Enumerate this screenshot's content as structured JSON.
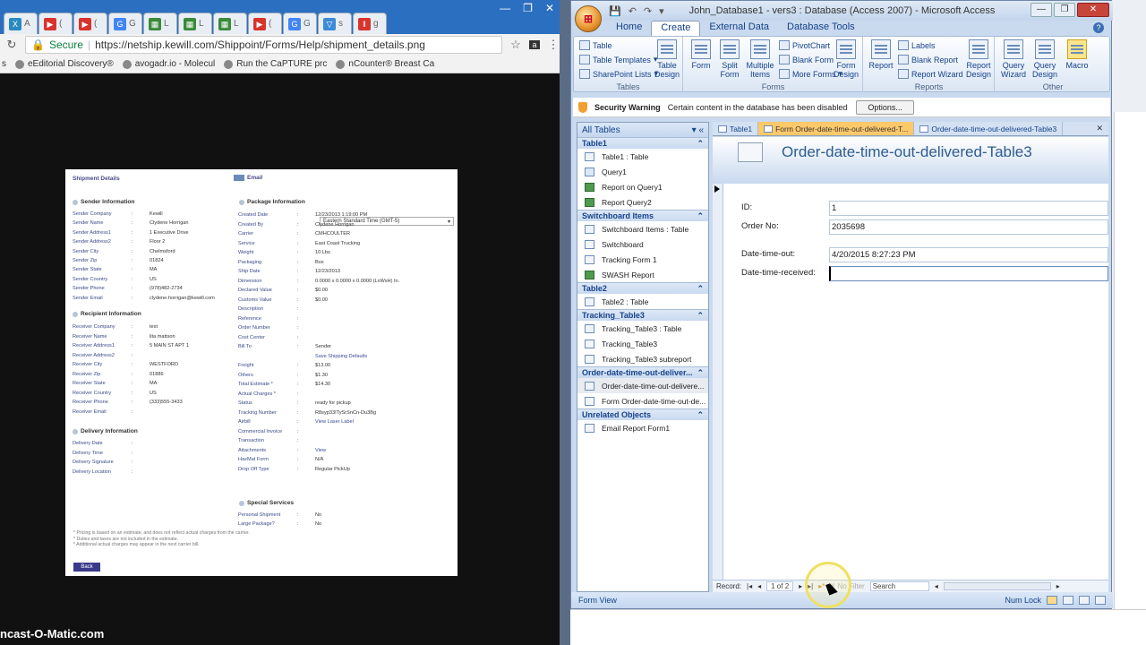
{
  "chrome": {
    "tabs": [
      {
        "fav": "X",
        "fav_color": "#2a8ac0",
        "text": "A"
      },
      {
        "fav": "▶",
        "fav_color": "#d8342c",
        "text": "("
      },
      {
        "fav": "▶",
        "fav_color": "#d8342c",
        "text": "("
      },
      {
        "fav": "G",
        "fav_color": "#4285f4",
        "text": "G"
      },
      {
        "fav": "▦",
        "fav_color": "#3a8a3a",
        "text": "L"
      },
      {
        "fav": "▦",
        "fav_color": "#3a8a3a",
        "text": "L"
      },
      {
        "fav": "▦",
        "fav_color": "#3a8a3a",
        "text": "L"
      },
      {
        "fav": "▶",
        "fav_color": "#d8342c",
        "text": "("
      },
      {
        "fav": "G",
        "fav_color": "#4285f4",
        "text": "G"
      },
      {
        "fav": "▽",
        "fav_color": "#3b8ad8",
        "text": "s"
      },
      {
        "fav": "‖",
        "fav_color": "#d8342c",
        "text": "g"
      }
    ],
    "secure_label": "Secure",
    "url": "https://netship.kewill.com/Shippoint/Forms/Help/shipment_details.png",
    "bookmarks": [
      "eEditorial Discovery®",
      "avogadr.io - Molecul",
      "Run the CaPTURE prc",
      "nCounter® Breast Ca"
    ]
  },
  "shipment": {
    "title": "Shipment Details",
    "email_link": "Email",
    "sender_header": "Sender Information",
    "sender_rows": [
      {
        "l": "Sender Company",
        "v": "Kewill"
      },
      {
        "l": "Sender Name",
        "v": "Clydene Horrigan"
      },
      {
        "l": "Sender Address1",
        "v": "1 Executive Drive"
      },
      {
        "l": "Sender Address2",
        "v": "Floor 2"
      },
      {
        "l": "Sender City",
        "v": "Chelmsford"
      },
      {
        "l": "Sender Zip",
        "v": "01824"
      },
      {
        "l": "Sender State",
        "v": "MA"
      },
      {
        "l": "Sender Country",
        "v": "US"
      },
      {
        "l": "Sender Phone",
        "v": "(978)482-2734"
      },
      {
        "l": "Sender Email",
        "v": "clydene.horrigan@kewill.com"
      }
    ],
    "recipient_header": "Recipient Information",
    "recipient_rows": [
      {
        "l": "Receiver Company",
        "v": "test"
      },
      {
        "l": "Receiver Name",
        "v": "lita mattson"
      },
      {
        "l": "Receiver Address1",
        "v": "5 MAIN ST APT 1"
      },
      {
        "l": "Receiver Address2",
        "v": ""
      },
      {
        "l": "Receiver City",
        "v": "WESTFORD"
      },
      {
        "l": "Receiver Zip",
        "v": "01886"
      },
      {
        "l": "Receiver State",
        "v": "MA"
      },
      {
        "l": "Receiver Country",
        "v": "US"
      },
      {
        "l": "Receiver Phone",
        "v": "(333)555-3433"
      },
      {
        "l": "Receiver Email",
        "v": ""
      }
    ],
    "delivery_header": "Delivery Information",
    "delivery_rows": [
      {
        "l": "Delivery Date",
        "v": ""
      },
      {
        "l": "Delivery Time",
        "v": ""
      },
      {
        "l": "Delivery Signature",
        "v": ""
      },
      {
        "l": "Delivery Location",
        "v": ""
      }
    ],
    "package_header": "Package Information",
    "timezone": "Eastern Standard Time (GMT-5)",
    "package_rows": [
      {
        "l": "Created Date",
        "v": "12/23/2013 1:19:00 PM"
      },
      {
        "l": "Created By",
        "v": "Clydene Horrigan"
      },
      {
        "l": "Carrier",
        "v": "CMHCOULTER"
      },
      {
        "l": "Service",
        "v": "East Coast Trucking"
      },
      {
        "l": "Weight",
        "v": "10 Lbs"
      },
      {
        "l": "Packaging",
        "v": "Box"
      },
      {
        "l": "Ship Date",
        "v": "12/23/2013"
      },
      {
        "l": "Dimension",
        "v": "0.0000 x 0.0000 x 0.0000 (LxWxH) In."
      },
      {
        "l": "Declared Value",
        "v": "$0.00"
      },
      {
        "l": "Customs Value",
        "v": "$0.00"
      },
      {
        "l": "Description",
        "v": ""
      },
      {
        "l": "Reference",
        "v": ""
      },
      {
        "l": "Order Number",
        "v": ""
      },
      {
        "l": "Cost Center",
        "v": ""
      },
      {
        "l": "Bill To",
        "v": "Sender"
      },
      {
        "l": "",
        "v": "Save Shipping Defaults"
      },
      {
        "l": "Freight",
        "v": "$13.00"
      },
      {
        "l": "Others",
        "v": "$1.30"
      },
      {
        "l": "Total Estimate *",
        "v": "$14.30"
      },
      {
        "l": "Actual Charges *",
        "v": ""
      },
      {
        "l": "Status",
        "v": "ready for pickup"
      },
      {
        "l": "Tracking Number",
        "v": "R8syp33ITySrSnCn-Du3Bg"
      },
      {
        "l": "Airbill",
        "v": "View Laser Label"
      },
      {
        "l": "Commercial Invoice",
        "v": ""
      },
      {
        "l": "Transaction",
        "v": ""
      },
      {
        "l": "Attachments",
        "v": "View"
      },
      {
        "l": "HazMat Form",
        "v": "N/A"
      },
      {
        "l": "Drop Off Type",
        "v": "Regular PickUp"
      }
    ],
    "special_header": "Special Services",
    "special_rows": [
      {
        "l": "Personal Shipment",
        "v": "No"
      },
      {
        "l": "Large Package?",
        "v": "No"
      }
    ],
    "notes": [
      "* Pricing is based on an estimate, and does not reflect actual charges from the carrier.",
      "* Duties and taxes are not included in the estimate.",
      "* Additional actual charges may appear in the next carrier bill."
    ],
    "back_button": "Back"
  },
  "watermark": "ncast-O-Matic.com",
  "access": {
    "title": "John_Database1 - vers3 : Database (Access 2007) - Microsoft Access",
    "ribbon_tabs": [
      "Home",
      "Create",
      "External Data",
      "Database Tools"
    ],
    "active_tab": "Create",
    "groups": {
      "tables": {
        "label": "Tables",
        "table": "Table",
        "templates": "Table Templates",
        "sharepoint": "SharePoint Lists",
        "design": "Table Design"
      },
      "forms": {
        "label": "Forms",
        "form": "Form",
        "split": "Split Form",
        "multiple": "Multiple Items",
        "pivot": "PivotChart",
        "blank": "Blank Form",
        "more": "More Forms",
        "design": "Form Design"
      },
      "reports": {
        "label": "Reports",
        "report": "Report",
        "labels": "Labels",
        "blank": "Blank Report",
        "wizard": "Report Wizard",
        "design": "Report Design"
      },
      "other": {
        "label": "Other",
        "qwizard": "Query Wizard",
        "qdesign": "Query Design",
        "macro": "Macro"
      }
    },
    "security": {
      "title": "Security Warning",
      "message": "Certain content in the database has been disabled",
      "options": "Options..."
    },
    "nav_header": "All Tables",
    "nav_groups": [
      {
        "name": "Table1",
        "items": [
          {
            "t": "Table1 : Table",
            "k": "t"
          },
          {
            "t": "Query1",
            "k": "q"
          },
          {
            "t": "Report on Query1",
            "k": "r"
          },
          {
            "t": "Report Query2",
            "k": "r"
          }
        ]
      },
      {
        "name": "Switchboard Items",
        "items": [
          {
            "t": "Switchboard Items : Table",
            "k": "t"
          },
          {
            "t": "Switchboard",
            "k": "f"
          },
          {
            "t": "Tracking Form 1",
            "k": "f"
          },
          {
            "t": "SWASH Report",
            "k": "r"
          }
        ]
      },
      {
        "name": "Table2",
        "items": [
          {
            "t": "Table2 : Table",
            "k": "t"
          }
        ]
      },
      {
        "name": "Tracking_Table3",
        "items": [
          {
            "t": "Tracking_Table3 : Table",
            "k": "t"
          },
          {
            "t": "Tracking_Table3",
            "k": "f"
          },
          {
            "t": "Tracking_Table3 subreport",
            "k": "f"
          }
        ]
      },
      {
        "name": "Order-date-time-out-deliver...",
        "items": [
          {
            "t": "Order-date-time-out-delivere...",
            "k": "t",
            "sel": true
          },
          {
            "t": "Form Order-date-time-out-de...",
            "k": "f"
          }
        ]
      },
      {
        "name": "Unrelated Objects",
        "items": [
          {
            "t": "Email Report Form1",
            "k": "f"
          }
        ]
      }
    ],
    "doc_tabs": [
      {
        "t": "Table1",
        "active": false
      },
      {
        "t": "Form Order-date-time-out-delivered-T...",
        "active": true
      },
      {
        "t": "Order-date-time-out-delivered-Table3",
        "active": false
      }
    ],
    "form_title": "Order-date-time-out-delivered-Table3",
    "fields": [
      {
        "l": "ID:",
        "v": "1"
      },
      {
        "l": "Order No:",
        "v": "2035698"
      },
      {
        "l": "Date-time-out:",
        "v": "4/20/2015 8:27:23 PM"
      },
      {
        "l": "Date-time-received:",
        "v": ""
      }
    ],
    "record_nav": {
      "label": "Record:",
      "current": "1 of 2",
      "nofilter": "No Filter",
      "search": "Search"
    },
    "status": {
      "view": "Form View",
      "numlock": "Num Lock"
    }
  }
}
